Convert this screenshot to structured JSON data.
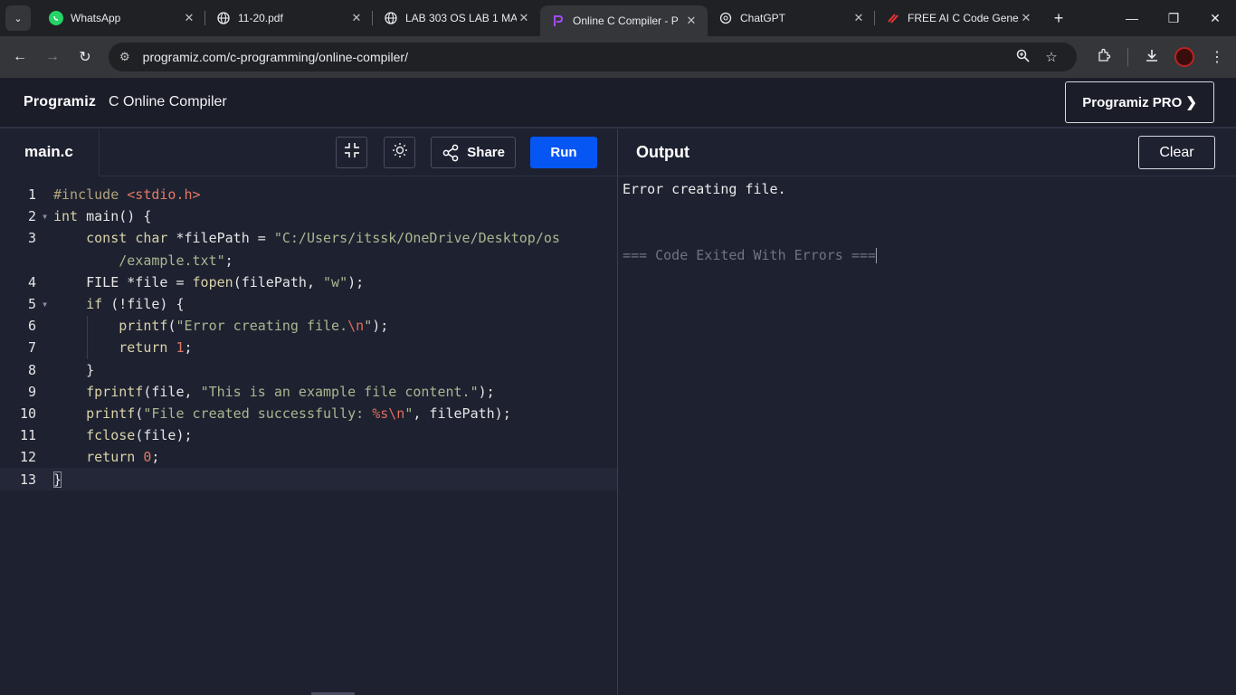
{
  "browser": {
    "tabs": [
      {
        "title": "WhatsApp",
        "icon": "whatsapp-icon"
      },
      {
        "title": "11-20.pdf",
        "icon": "globe-icon"
      },
      {
        "title": "LAB 303 OS LAB 1 MA",
        "icon": "globe-icon"
      },
      {
        "title": "Online C Compiler - P",
        "icon": "programiz-icon",
        "active": true
      },
      {
        "title": "ChatGPT",
        "icon": "chatgpt-icon"
      },
      {
        "title": "FREE AI C Code Gene",
        "icon": "codegen-icon"
      }
    ],
    "new_tab": "+",
    "url": "programiz.com/c-programming/online-compiler/"
  },
  "header": {
    "logo": "Programiz",
    "title": "C Online Compiler",
    "pro_button": "Programiz PRO ❯"
  },
  "editor": {
    "file_name": "main.c",
    "share_label": "Share",
    "run_label": "Run",
    "line_numbers": [
      "1",
      "2",
      "3",
      "",
      "4",
      "5",
      "6",
      "7",
      "8",
      "9",
      "10",
      "11",
      "12",
      "13"
    ]
  },
  "output": {
    "title": "Output",
    "clear_label": "Clear",
    "lines": [
      "Error creating file."
    ],
    "exit_message": "=== Code Exited With Errors ==="
  },
  "colors": {
    "run_button": "#0556f3",
    "background": "#1e2130"
  }
}
